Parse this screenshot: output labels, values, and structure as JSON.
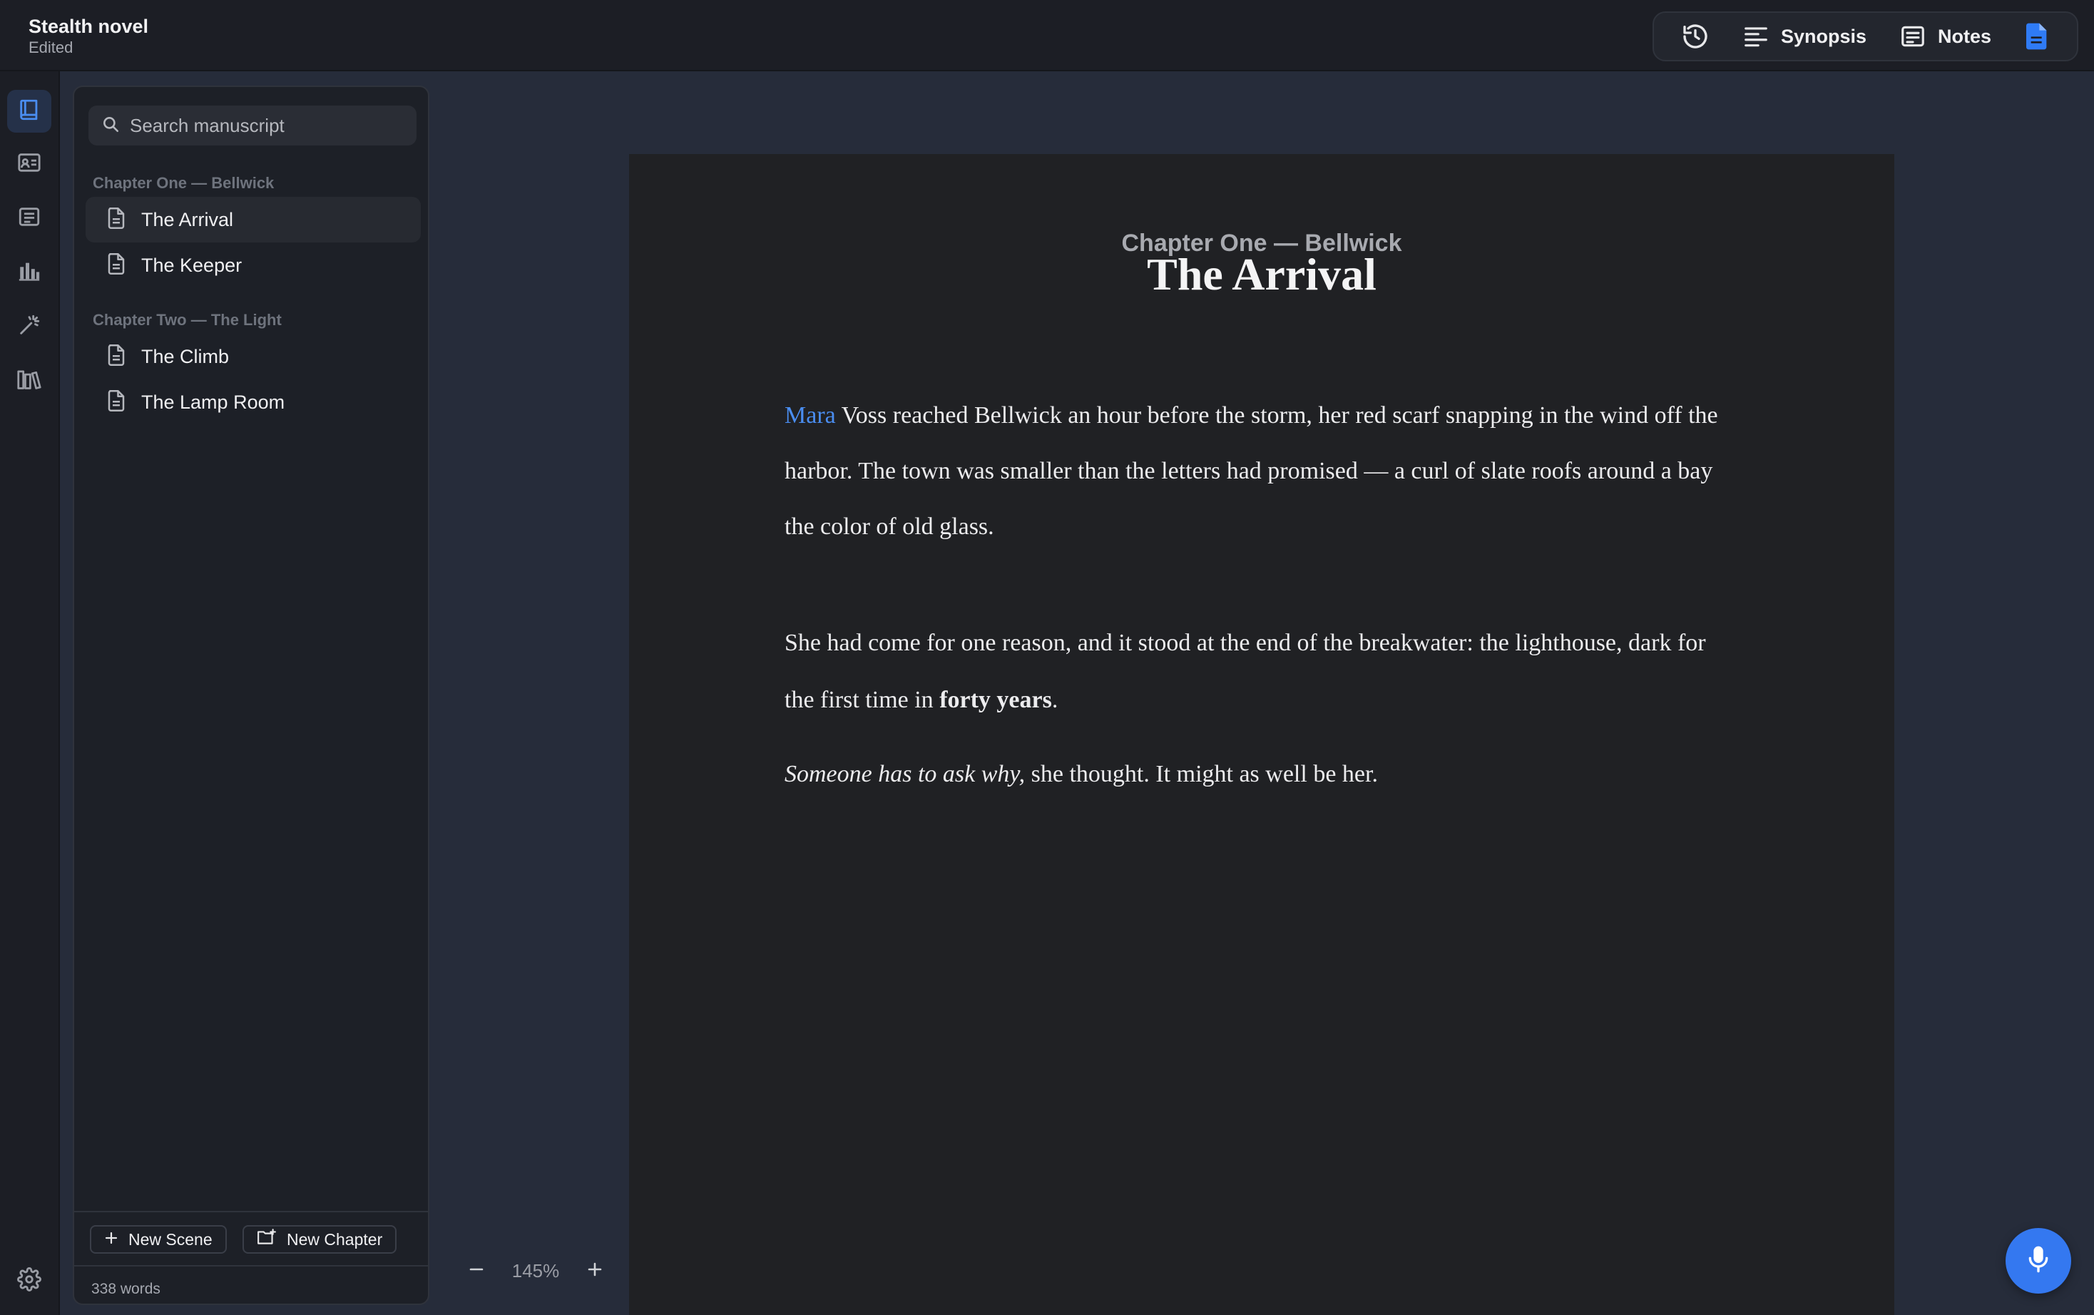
{
  "document": {
    "title": "Stealth novel",
    "status": "Edited"
  },
  "toolbar": {
    "items": [
      {
        "icon": "history-icon",
        "label": ""
      },
      {
        "icon": "synopsis-icon",
        "label": "Synopsis"
      },
      {
        "icon": "notes-icon",
        "label": "Notes"
      },
      {
        "icon": "document-icon",
        "label": ""
      }
    ],
    "synopsis_label": "Synopsis",
    "notes_label": "Notes",
    "accent_color": "#2f7bf5"
  },
  "rail": {
    "items": [
      {
        "icon": "book-icon",
        "active": true
      },
      {
        "icon": "contact-card-icon",
        "active": false
      },
      {
        "icon": "notes-list-icon",
        "active": false
      },
      {
        "icon": "bar-chart-icon",
        "active": false
      },
      {
        "icon": "magic-wand-icon",
        "active": false
      },
      {
        "icon": "library-icon",
        "active": false
      }
    ],
    "bottom_icon": "gear-icon"
  },
  "manuscript": {
    "search_placeholder": "Search manuscript",
    "chapters": [
      {
        "title": "Chapter One — Bellwick",
        "scenes": [
          {
            "label": "The Arrival",
            "active": true
          },
          {
            "label": "The Keeper",
            "active": false
          }
        ]
      },
      {
        "title": "Chapter Two — The Light",
        "scenes": [
          {
            "label": "The Climb",
            "active": false
          },
          {
            "label": "The Lamp Room",
            "active": false
          }
        ]
      }
    ],
    "new_scene_label": "New Scene",
    "new_chapter_label": "New Chapter",
    "word_count": "338 words"
  },
  "zoom": {
    "value": "145%"
  },
  "page": {
    "chapter": "Chapter One — Bellwick",
    "title": "The Arrival",
    "p1": {
      "link": "Mara",
      "text": " Voss reached Bellwick an hour before the storm, her red scarf snapping in the wind off the harbor. The town was smaller than the letters had promised — a curl of slate roofs around a bay the color of old glass."
    },
    "p2": {
      "before": "She had come for one reason, and it stood at the end of the breakwater: the lighthouse, dark for the first time in ",
      "bold": "forty years",
      "after": "."
    },
    "p3": {
      "italic": "Someone has to ask why,",
      "after": " she thought. It might as well be her."
    },
    "link_color": "#4a8df0"
  },
  "mic": {
    "icon": "microphone-icon",
    "color": "#3478f0"
  }
}
